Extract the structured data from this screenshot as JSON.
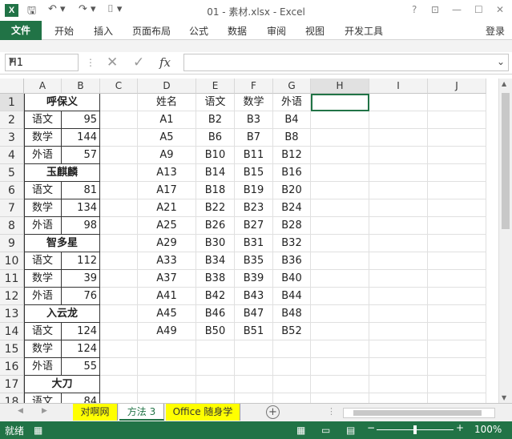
{
  "app": {
    "logo_letter": "X",
    "title": "01 - 素材.xlsx - Excel",
    "login": "登录",
    "win_buttons": [
      "?",
      "⊡",
      "—",
      "☐",
      "✕"
    ]
  },
  "ribbon_tabs": [
    "文件",
    "开始",
    "插入",
    "页面布局",
    "公式",
    "数据",
    "审阅",
    "视图",
    "开发工具"
  ],
  "namebox": {
    "value": "H1"
  },
  "formula": {
    "fx": "fx",
    "cancel": "✕",
    "enter": "✓",
    "value": ""
  },
  "columns": [
    "A",
    "B",
    "C",
    "D",
    "E",
    "F",
    "G",
    "H",
    "I",
    "J"
  ],
  "rows": [
    "1",
    "2",
    "3",
    "4",
    "5",
    "6",
    "7",
    "8",
    "9",
    "10",
    "11",
    "12",
    "13",
    "14",
    "15",
    "16",
    "17",
    "18"
  ],
  "left_table": [
    {
      "name": "呼保义",
      "items": [
        [
          "语文",
          "95"
        ],
        [
          "数学",
          "144"
        ],
        [
          "外语",
          "57"
        ]
      ]
    },
    {
      "name": "玉麒麟",
      "items": [
        [
          "语文",
          "81"
        ],
        [
          "数学",
          "134"
        ],
        [
          "外语",
          "98"
        ]
      ]
    },
    {
      "name": "智多星",
      "items": [
        [
          "语文",
          "112"
        ],
        [
          "数学",
          "39"
        ],
        [
          "外语",
          "76"
        ]
      ]
    },
    {
      "name": "入云龙",
      "items": [
        [
          "语文",
          "124"
        ],
        [
          "数学",
          "124"
        ],
        [
          "外语",
          "55"
        ]
      ]
    },
    {
      "name": "大刀",
      "items": [
        [
          "语文",
          "84"
        ]
      ]
    }
  ],
  "right_table": {
    "header": [
      "姓名",
      "语文",
      "数学",
      "外语"
    ],
    "rows": [
      [
        "A1",
        "B2",
        "B3",
        "B4"
      ],
      [
        "A5",
        "B6",
        "B7",
        "B8"
      ],
      [
        "A9",
        "B10",
        "B11",
        "B12"
      ],
      [
        "A13",
        "B14",
        "B15",
        "B16"
      ],
      [
        "A17",
        "B18",
        "B19",
        "B20"
      ],
      [
        "A21",
        "B22",
        "B23",
        "B24"
      ],
      [
        "A25",
        "B26",
        "B27",
        "B28"
      ],
      [
        "A29",
        "B30",
        "B31",
        "B32"
      ],
      [
        "A33",
        "B34",
        "B35",
        "B36"
      ],
      [
        "A37",
        "B38",
        "B39",
        "B40"
      ],
      [
        "A41",
        "B42",
        "B43",
        "B44"
      ],
      [
        "A45",
        "B46",
        "B47",
        "B48"
      ],
      [
        "A49",
        "B50",
        "B51",
        "B52"
      ]
    ]
  },
  "sheets": [
    {
      "name": "对啊网",
      "active": false
    },
    {
      "name": "方法 3",
      "active": true
    },
    {
      "name": "Office 随身学",
      "active": false
    }
  ],
  "status": {
    "ready": "就绪",
    "zoom": "100%"
  },
  "colors": {
    "accent": "#217346",
    "sheet_tab": "#ffff00"
  }
}
